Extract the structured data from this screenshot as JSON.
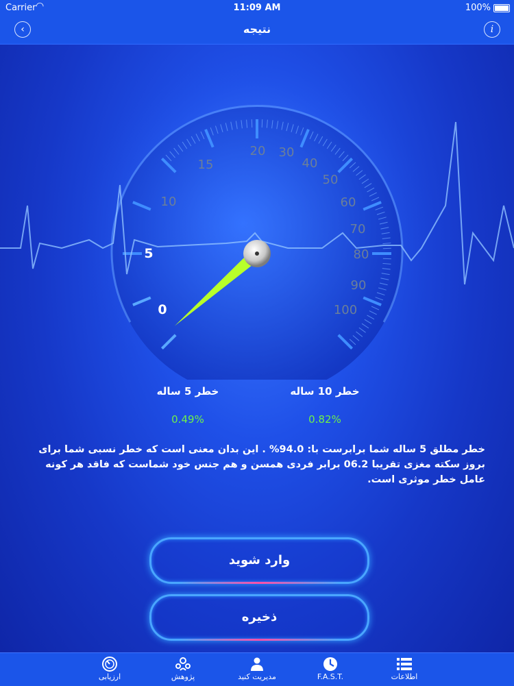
{
  "status_bar": {
    "carrier": "Carrier",
    "time": "11:09 AM",
    "battery": "100%"
  },
  "nav": {
    "title": "نتیجه",
    "back_icon": "chevron-left-icon",
    "info_icon": "info-icon"
  },
  "gauge": {
    "ticks": [
      "0",
      "5",
      "10",
      "15",
      "20",
      "30",
      "40",
      "50",
      "60",
      "70",
      "80",
      "90",
      "100"
    ],
    "needle_value": 0.82,
    "accent_color": "#6ef04a",
    "needle_color": "#b8ff2a"
  },
  "risk": {
    "ten_year_label": "خطر 10 ساله",
    "ten_year_value": "0.82%",
    "five_year_label": "خطر 5 ساله",
    "five_year_value": "0.49%"
  },
  "description": "خطر مطلق  5 ساله شما برابرست با: 94.0% . این بدان معنی است که خطر نسبی شما برای بروز سکته مغزی تقریبا 06.2 برابر فردی همسن و هم جنس خود شماست که فاقد هر کونه عامل خطر موثری است.",
  "buttons": {
    "enter": "وارد شوید",
    "save": "ذخیره"
  },
  "tabs": [
    {
      "label": "اطلاعات",
      "icon": "list-icon"
    },
    {
      "label": "F.A.S.T.",
      "icon": "clock-icon"
    },
    {
      "label": "مدیریت کنید",
      "icon": "doctor-icon"
    },
    {
      "label": "پژوهش",
      "icon": "research-icon"
    },
    {
      "label": "ارزیابی",
      "icon": "gauge-icon"
    }
  ]
}
